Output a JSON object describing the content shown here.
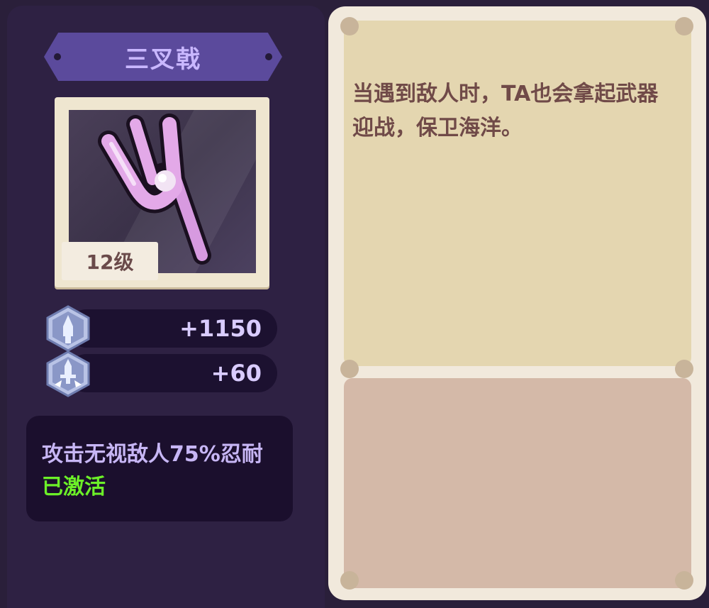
{
  "item": {
    "name": "三叉戟",
    "level": "12级",
    "icon": "trident-icon"
  },
  "stats": [
    {
      "icon": "attack-sword-icon",
      "value": "+1150"
    },
    {
      "icon": "pierce-sword-icon",
      "value": "+60"
    }
  ],
  "effect": {
    "text": "攻击无视敌人75%忍耐",
    "status": "已激活",
    "status_color": "#6cf028"
  },
  "description": {
    "text": "当遇到敌人时，TA也会拿起武器迎战，保卫海洋。"
  },
  "colors": {
    "title_text": "#c9b7ff",
    "banner": "#5b4a9c",
    "trident": "#e3a9e8"
  }
}
